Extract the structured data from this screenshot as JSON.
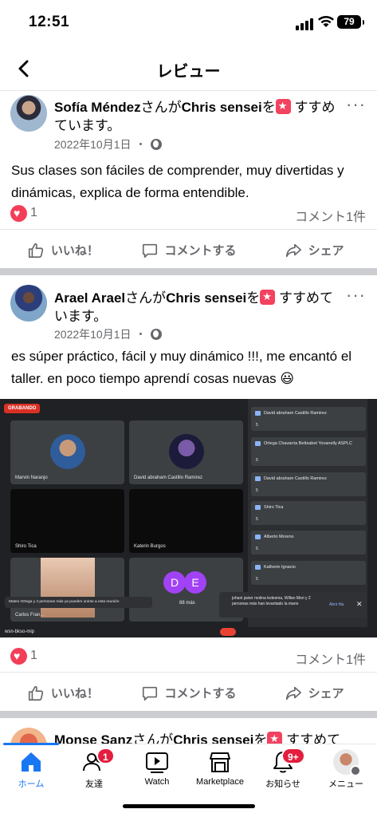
{
  "status_bar": {
    "time": "12:51",
    "battery": "79"
  },
  "header": {
    "title": "レビュー"
  },
  "posts": [
    {
      "author": "Sofía Méndez",
      "mid_text": "さんが",
      "target": "Chris sensei",
      "post_text": "を",
      "tail_text": " すすめています。",
      "date": "2022年10月1日",
      "dot": "・",
      "body": "Sus clases son fáciles de comprender, muy divertidas y dinámicas, explica de forma entendible.",
      "reaction_count": "1",
      "comment_count": "コメント1件"
    },
    {
      "author": "Arael Arael",
      "mid_text": "さんが",
      "target": "Chris sensei",
      "post_text": "を",
      "tail_text": " すすめています。",
      "date": "2022年10月1日",
      "dot": "・",
      "body": "es súper práctico, fácil y muy dinámico !!!, me encantó el taller. en poco tiempo aprendí cosas nuevas 😃",
      "reaction_count": "1",
      "comment_count": "コメント1件"
    },
    {
      "author": "Monse Sanz",
      "mid_text": "さんが",
      "target": "Chris sensei",
      "post_text": "を",
      "tail_text": " すすめて"
    }
  ],
  "actions": {
    "like": "いいね！",
    "comment": "コメントする",
    "share": "シェア"
  },
  "meeting": {
    "recording": "GRABANDO",
    "tiles": [
      {
        "name": "Marvin Naranjo"
      },
      {
        "name": "David abraham Castillo Ramirez"
      },
      {
        "name": "Shiro Tica"
      },
      {
        "name": "Katerin Burgos"
      },
      {
        "name": "Carlos Fran..."
      },
      {
        "name": "88 más"
      }
    ],
    "initials": [
      "D",
      "E"
    ],
    "sidebar": [
      {
        "name": "David abraham Castillo Ramirez",
        "count": "5"
      },
      {
        "name": "Ortega Chavarria Bettsabet Yovanelly ASPLC",
        "count": "5"
      },
      {
        "name": "David abraham Castillo Ramirez",
        "count": "5"
      },
      {
        "name": "Shiro Tica",
        "count": "5"
      },
      {
        "name": "Alberto Moreno",
        "count": "5"
      },
      {
        "name": "Katherin Ignacio",
        "count": "5"
      }
    ],
    "toast_left": "Mateo Ortega y 4 personas más ya pueden unirse a esta reunión",
    "toast_right": "johani javier molina ledesma, Willan Mori y 2 personas más han levantado la mano",
    "toast_action": "Abrir fila",
    "meeting_code": "wsn-bkso-mip"
  },
  "nav": {
    "items": [
      {
        "label": "ホーム",
        "icon": "home-icon"
      },
      {
        "label": "友達",
        "icon": "friends-icon",
        "badge": "1"
      },
      {
        "label": "Watch",
        "icon": "watch-icon"
      },
      {
        "label": "Marketplace",
        "icon": "marketplace-icon"
      },
      {
        "label": "お知らせ",
        "icon": "bell-icon",
        "badge": "9+"
      },
      {
        "label": "メニュー",
        "icon": "menu-avatar"
      }
    ]
  },
  "colors": {
    "accent": "#1877f2",
    "heart": "#f33e58",
    "badge": "#e41e3f",
    "recommend": "#f3425f"
  }
}
